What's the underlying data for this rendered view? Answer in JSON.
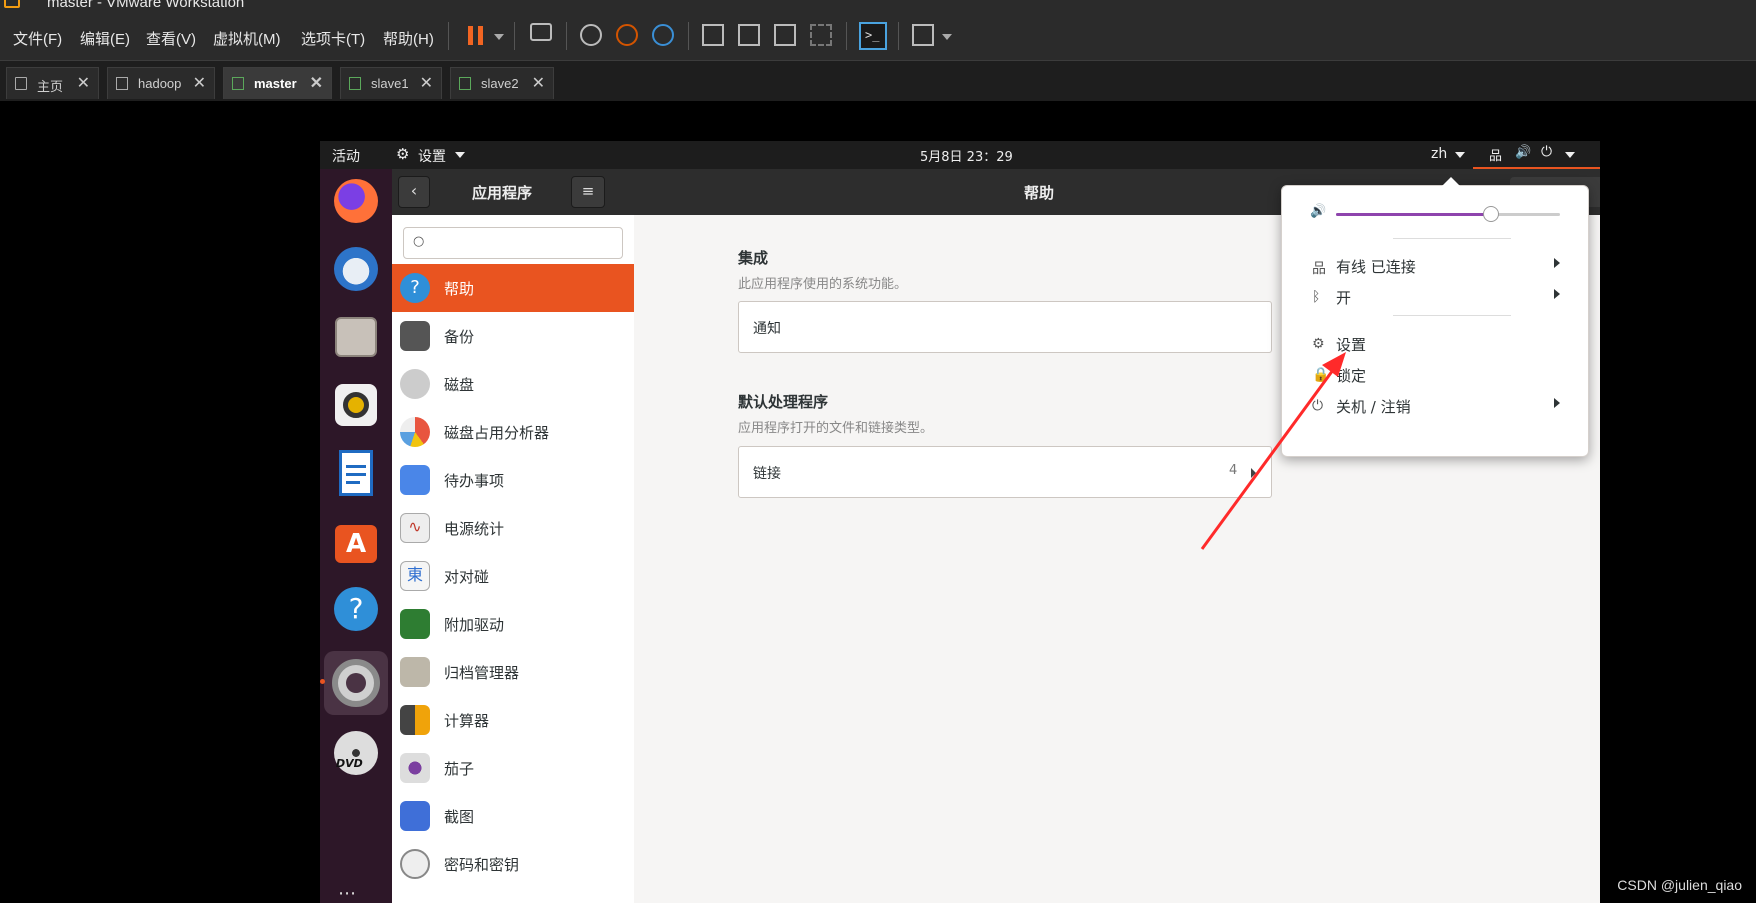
{
  "window": {
    "title": "master - VMware Workstation"
  },
  "menu": [
    "文件(F)",
    "编辑(E)",
    "查看(V)",
    "虚拟机(M)",
    "选项卡(T)",
    "帮助(H)"
  ],
  "tabs": [
    {
      "label": "主页",
      "active": false
    },
    {
      "label": "hadoop",
      "active": false
    },
    {
      "label": "master",
      "active": true
    },
    {
      "label": "slave1",
      "active": false
    },
    {
      "label": "slave2",
      "active": false
    }
  ],
  "ubuntu": {
    "topbar": {
      "activities": "活动",
      "app_menu": "设置",
      "clock": "5月8日  23：29",
      "lang": "zh"
    },
    "header": {
      "left_title": "应用程序",
      "title": "帮助"
    },
    "sidebar_items": [
      "帮助",
      "备份",
      "磁盘",
      "磁盘占用分析器",
      "待办事项",
      "电源统计",
      "对对碰",
      "附加驱动",
      "归档管理器",
      "计算器",
      "茄子",
      "截图",
      "密码和密钥"
    ],
    "content": {
      "section1_title": "集成",
      "section1_desc": "此应用程序使用的系统功能。",
      "row_notify": "通知",
      "section2_title": "默认处理程序",
      "section2_desc": "应用程序打开的文件和链接类型。",
      "row_links": "链接",
      "row_links_count": "4"
    },
    "popup": {
      "volume_level": 0.69,
      "network": "有线 已连接",
      "bluetooth": "开",
      "settings": "设置",
      "lock": "锁定",
      "power": "关机 / 注销"
    }
  },
  "watermark": "CSDN @julien_qiao",
  "colors": {
    "accent": "#e95420",
    "dock": "#2d1728",
    "vmware_bg": "#2b2b2b",
    "arrow": "#ff2a2a"
  }
}
